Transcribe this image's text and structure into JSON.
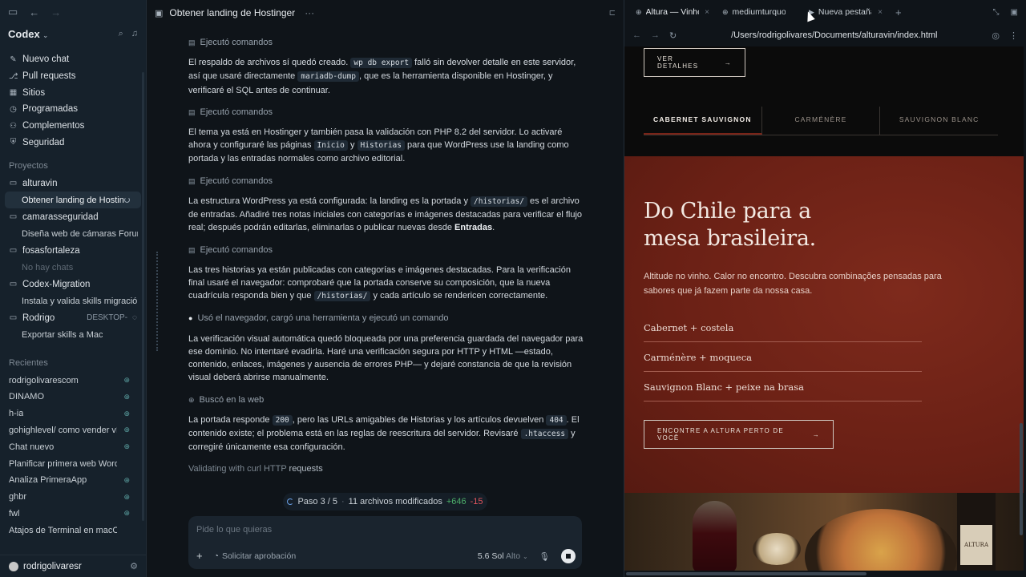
{
  "sidebar": {
    "brand": "Codex",
    "nav": [
      {
        "icon": "✎",
        "label": "Nuevo chat"
      },
      {
        "icon": "⎇",
        "label": "Pull requests"
      },
      {
        "icon": "▦",
        "label": "Sitios"
      },
      {
        "icon": "◷",
        "label": "Programadas"
      },
      {
        "icon": "⚇",
        "label": "Complementos"
      },
      {
        "icon": "⛨",
        "label": "Seguridad"
      }
    ],
    "projects_label": "Proyectos",
    "projects": [
      {
        "name": "alturavin",
        "subs": [
          {
            "label": "Obtener landing de Hostinger",
            "active": true
          }
        ]
      },
      {
        "name": "camarasseguridad",
        "subs": [
          {
            "label": "Diseña web de cámaras Forum"
          }
        ]
      },
      {
        "name": "fosasfortaleza",
        "subs": [
          {
            "label": "No hay chats",
            "empty": true
          }
        ]
      },
      {
        "name": "Codex-Migration",
        "subs": [
          {
            "label": "Instala y valida skills migración"
          }
        ]
      },
      {
        "name": "Rodrigo",
        "device": "DESKTOP-",
        "subs": [
          {
            "label": "Exportar skills a Mac"
          }
        ]
      }
    ],
    "recent_label": "Recientes",
    "recent": [
      {
        "label": "rodrigolivarescom",
        "globe": true
      },
      {
        "label": "DINAMO",
        "globe": true
      },
      {
        "label": "h-ia",
        "globe": true
      },
      {
        "label": "gohighlevel/ como vender vía",
        "globe": true
      },
      {
        "label": "Chat nuevo",
        "globe": true
      },
      {
        "label": "Planificar primera web WordPress",
        "globe": false
      },
      {
        "label": "Analiza PrimeraApp",
        "globe": true
      },
      {
        "label": "ghbr",
        "globe": true
      },
      {
        "label": "fwl",
        "globe": true
      },
      {
        "label": "Atajos de Terminal en macOS",
        "globe": false
      }
    ],
    "user": "rodrigolivaresr"
  },
  "chat": {
    "title": "Obtener landing de Hostinger",
    "menu": "···",
    "step_label_commands": "Ejecutó comandos",
    "p1_a": "El respaldo de archivos sí quedó creado.",
    "p1_code1": "wp db export",
    "p1_b": "falló sin devolver detalle en este servidor, así que usaré directamente",
    "p1_code2": "mariadb-dump",
    "p1_c": ", que es la herramienta disponible en Hostinger, y verificaré el SQL antes de continuar.",
    "p2_a": "El tema ya está en Hostinger y también pasa la validación con PHP 8.2 del servidor. Lo activaré ahora y configuraré las páginas",
    "p2_code1": "Inicio",
    "p2_b": "y",
    "p2_code2": "Historias",
    "p2_c": "para que WordPress use la landing como portada y las entradas normales como archivo editorial.",
    "p3_a": "La estructura WordPress ya está configurada: la landing es la portada y",
    "p3_code1": "/historias/",
    "p3_b": "es el archivo de entradas. Añadiré tres notas iniciales con categorías e imágenes destacadas para verificar el flujo real; después podrán editarlas, eliminarlas o publicar nuevas desde",
    "p3_bold": "Entradas",
    "p3_c": ".",
    "p4_a": "Las tres historias ya están publicadas con categorías e imágenes destacadas. Para la verificación final usaré el navegador: comprobaré que la portada conserve su composición, que la nueva cuadrícula responda bien y que",
    "p4_code1": "/historias/",
    "p4_b": "y cada artículo se rendericen correctamente.",
    "step_browser": "Usó el navegador, cargó una herramienta y ejecutó un comando",
    "p5": "La verificación visual automática quedó bloqueada por una preferencia guardada del navegador para ese dominio. No intentaré evadirla. Haré una verificación segura por HTTP y HTML —estado, contenido, enlaces, imágenes y ausencia de errores PHP— y dejaré constancia de que la revisión visual deberá abrirse manualmente.",
    "step_web": "Buscó en la web",
    "p6_a": "La portada responde",
    "p6_code1": "200",
    "p6_b": ", pero las URLs amigables de Historias y los artículos devuelven",
    "p6_code2": "404",
    "p6_c": ". El contenido existe; el problema está en las reglas de reescritura del servidor. Revisaré",
    "p6_code3": ".htaccess",
    "p6_d": "y corregiré únicamente esa configuración.",
    "thinking_a": "Validating with curl HTTP ",
    "thinking_b": "requests",
    "status": {
      "step": "Paso 3 / 5",
      "files": "11 archivos modificados",
      "added": "+646",
      "removed": "-15"
    },
    "composer": {
      "placeholder": "Pide lo que quieras",
      "approval": "Solicitar aprobación",
      "model": "5.6 Sol",
      "effort": "Alto"
    }
  },
  "browser": {
    "tabs": [
      {
        "label": "Altura — Vinhos",
        "active": true
      },
      {
        "label": "mediumturquoise",
        "active": false
      },
      {
        "label": "Nueva pestaña",
        "active": false
      }
    ],
    "url": "/Users/rodrigolivares/Documents/alturavin/index.html",
    "page": {
      "cta_details": "VER DETALHES",
      "wine_tabs": [
        "CABERNET SAUVIGNON",
        "CARMÉNÈRE",
        "SAUVIGNON BLANC"
      ],
      "hero_line1": "Do Chile para a",
      "hero_line2": "mesa brasileira.",
      "hero_text": "Altitude no vinho. Calor no encontro. Descubra combinações pensadas para sabores que já fazem parte da nossa casa.",
      "pairings": [
        "Cabernet + costela",
        "Carménère + moqueca",
        "Sauvignon Blanc + peixe na brasa"
      ],
      "cta_find": "ENCONTRE A ALTURA PERTO DE VOCÊ",
      "bottle_label": "ALTURA"
    }
  }
}
